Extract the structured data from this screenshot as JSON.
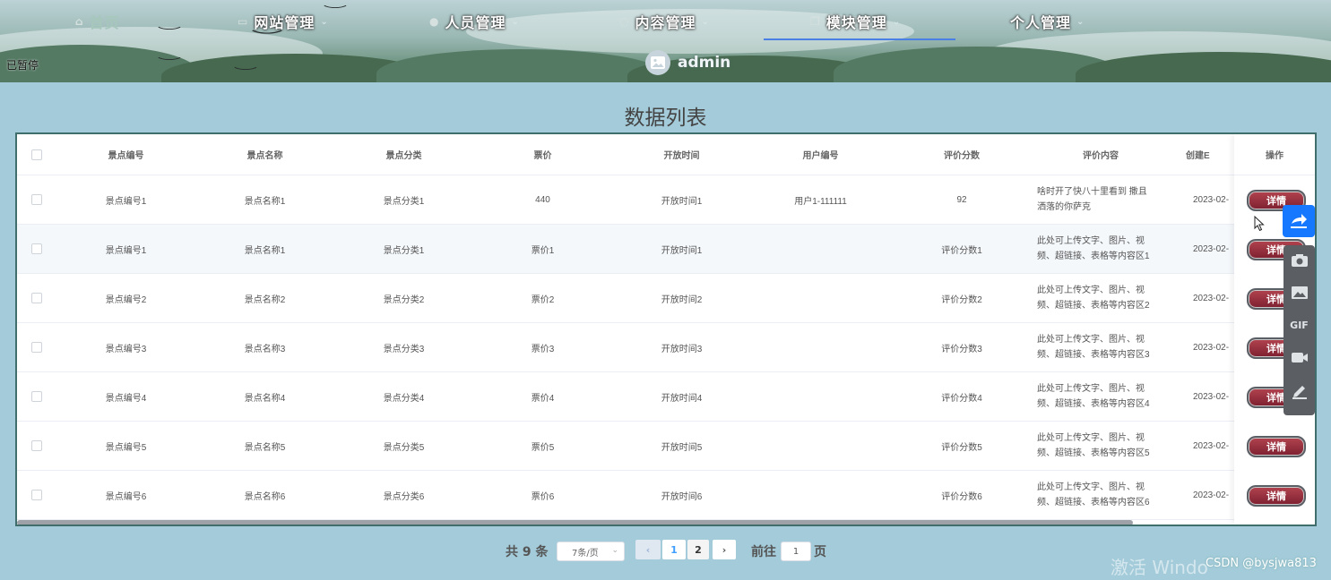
{
  "nav": {
    "items": [
      {
        "label": "首页",
        "icon": "home-icon"
      },
      {
        "label": "网站管理",
        "icon": "monitor-icon"
      },
      {
        "label": "人员管理",
        "icon": "user-icon"
      },
      {
        "label": "内容管理",
        "icon": "chat-icon"
      },
      {
        "label": "模块管理",
        "icon": "copy-icon"
      },
      {
        "label": "个人管理",
        "icon": ""
      }
    ],
    "chevron": "⌄"
  },
  "status": {
    "paused": "已暂停"
  },
  "user": {
    "name": "admin"
  },
  "page_title": "数据列表",
  "table": {
    "columns": [
      "景点编号",
      "景点名称",
      "景点分类",
      "票价",
      "开放时间",
      "用户编号",
      "评价分数",
      "评价内容",
      "创建E"
    ],
    "ops_header": "操作",
    "detail_label": "详情",
    "rows": [
      {
        "code": "景点编号1",
        "name": "景点名称1",
        "category": "景点分类1",
        "price": "440",
        "open": "开放时间1",
        "user": "用户1-111111",
        "score": "92",
        "review1": "啥时开了快八十里看到 撒且",
        "review2": "洒落的你萨克",
        "created": "2023-02-"
      },
      {
        "code": "景点编号1",
        "name": "景点名称1",
        "category": "景点分类1",
        "price": "票价1",
        "open": "开放时间1",
        "user": "",
        "score": "评价分数1",
        "review1": "此处可上传文字、图片、视",
        "review2": "频、超链接、表格等内容区1",
        "created": "2023-02-"
      },
      {
        "code": "景点编号2",
        "name": "景点名称2",
        "category": "景点分类2",
        "price": "票价2",
        "open": "开放时间2",
        "user": "",
        "score": "评价分数2",
        "review1": "此处可上传文字、图片、视",
        "review2": "频、超链接、表格等内容区2",
        "created": "2023-02-"
      },
      {
        "code": "景点编号3",
        "name": "景点名称3",
        "category": "景点分类3",
        "price": "票价3",
        "open": "开放时间3",
        "user": "",
        "score": "评价分数3",
        "review1": "此处可上传文字、图片、视",
        "review2": "频、超链接、表格等内容区3",
        "created": "2023-02-"
      },
      {
        "code": "景点编号4",
        "name": "景点名称4",
        "category": "景点分类4",
        "price": "票价4",
        "open": "开放时间4",
        "user": "",
        "score": "评价分数4",
        "review1": "此处可上传文字、图片、视",
        "review2": "频、超链接、表格等内容区4",
        "created": "2023-02-"
      },
      {
        "code": "景点编号5",
        "name": "景点名称5",
        "category": "景点分类5",
        "price": "票价5",
        "open": "开放时间5",
        "user": "",
        "score": "评价分数5",
        "review1": "此处可上传文字、图片、视",
        "review2": "频、超链接、表格等内容区5",
        "created": "2023-02-"
      },
      {
        "code": "景点编号6",
        "name": "景点名称6",
        "category": "景点分类6",
        "price": "票价6",
        "open": "开放时间6",
        "user": "",
        "score": "评价分数6",
        "review1": "此处可上传文字、图片、视",
        "review2": "频、超链接、表格等内容区6",
        "created": "2023-02-"
      }
    ]
  },
  "pagination": {
    "total": "共 9 条",
    "page_size": "7条/页",
    "pages": [
      "1",
      "2"
    ],
    "current": "1",
    "goto_label": "前往",
    "goto_value": "1",
    "page_label": "页"
  },
  "toolbar": {
    "gif_label": "GIF"
  },
  "overlay": {
    "watermark": "激活 Windo",
    "csdn": "CSDN @bysjwa813"
  },
  "colors": {
    "accent": "#1677ff",
    "nav_underline": "#4a7fe6",
    "detail_button": "#9b3140",
    "page_bg": "#a3cbd9"
  }
}
